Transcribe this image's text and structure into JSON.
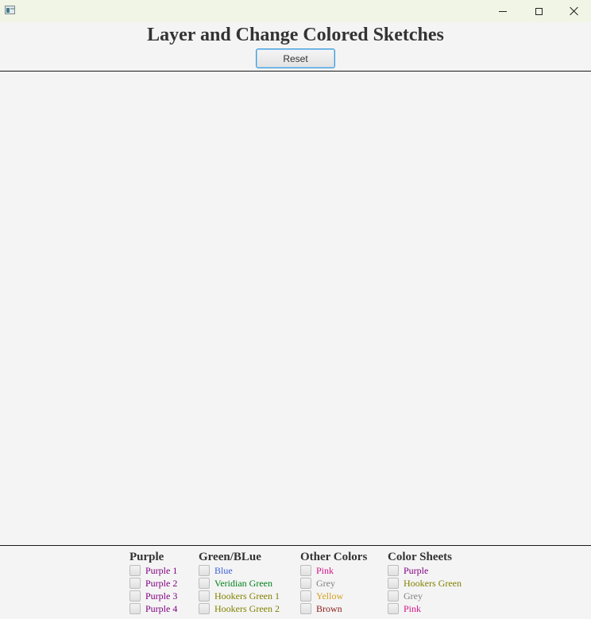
{
  "window": {
    "title": "",
    "controls": {
      "minimize": "minimize-icon",
      "maximize": "maximize-icon",
      "close": "close-icon"
    }
  },
  "header": {
    "title": "Layer and Change Colored Sketches",
    "reset_label": "Reset"
  },
  "groups": [
    {
      "heading": "Purple",
      "options": [
        {
          "label": "Purple 1",
          "color": "#800080",
          "checked": false
        },
        {
          "label": "Purple 2",
          "color": "#800080",
          "checked": false
        },
        {
          "label": "Purple 3",
          "color": "#800080",
          "checked": false
        },
        {
          "label": "Purple 4",
          "color": "#800080",
          "checked": false
        }
      ]
    },
    {
      "heading": "Green/BLue",
      "options": [
        {
          "label": "Blue",
          "color": "#3b5fd9",
          "checked": false
        },
        {
          "label": "Veridian Green",
          "color": "#00801a",
          "checked": false
        },
        {
          "label": "Hookers Green 1",
          "color": "#808000",
          "checked": false
        },
        {
          "label": "Hookers Green 2",
          "color": "#808000",
          "checked": false
        }
      ]
    },
    {
      "heading": "Other Colors",
      "options": [
        {
          "label": "Pink",
          "color": "#d4148a",
          "checked": false
        },
        {
          "label": "Grey",
          "color": "#808080",
          "checked": false
        },
        {
          "label": "Yellow",
          "color": "#d4a020",
          "checked": false
        },
        {
          "label": "Brown",
          "color": "#8b1a1a",
          "checked": false
        }
      ]
    },
    {
      "heading": "Color Sheets",
      "options": [
        {
          "label": "Purple",
          "color": "#800080",
          "checked": false
        },
        {
          "label": "Hookers Green",
          "color": "#808000",
          "checked": false
        },
        {
          "label": "Grey",
          "color": "#808080",
          "checked": false
        },
        {
          "label": "Pink",
          "color": "#d4148a",
          "checked": false
        }
      ]
    }
  ]
}
